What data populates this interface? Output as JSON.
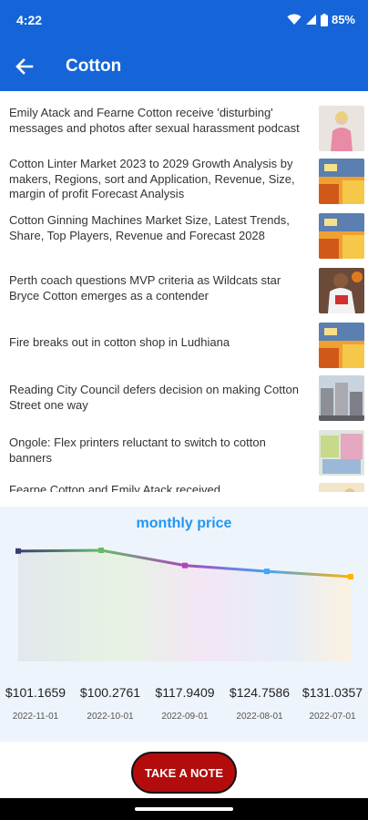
{
  "status_bar": {
    "time": "4:22",
    "battery": "85%"
  },
  "app_bar": {
    "title": "Cotton",
    "back_icon": "arrow-left-icon"
  },
  "news": [
    {
      "text": "Emily Atack and Fearne Cotton receive 'disturbing' messages and photos after sexual harassment podcast",
      "thumb": "woman-pink"
    },
    {
      "text": "Cotton Linter Market 2023 to 2029 Growth Analysis by makers, Regions, sort and Application, Revenue, Size, margin of profit Forecast Analysis",
      "thumb": "market-generic"
    },
    {
      "text": "Cotton Ginning Machines Market Size, Latest Trends, Share, Top Players, Revenue and Forecast 2028",
      "thumb": "market-generic"
    },
    {
      "text": "Perth coach questions MVP criteria as Wildcats star Bryce Cotton emerges as a contender",
      "thumb": "basketball"
    },
    {
      "text": "Fire breaks out in cotton shop in Ludhiana",
      "thumb": "market-generic"
    },
    {
      "text": "Reading City Council defers decision on making Cotton Street one way",
      "thumb": "city-street"
    },
    {
      "text": "Ongole: Flex printers reluctant to switch to cotton banners",
      "thumb": "banners"
    },
    {
      "text": "Fearne Cotton and Emily Atack received",
      "thumb": "partial"
    }
  ],
  "chart_data": {
    "type": "line",
    "title": "monthly price",
    "categories": [
      "2022-11-01",
      "2022-10-01",
      "2022-09-01",
      "2022-08-01",
      "2022-07-01"
    ],
    "value_labels": [
      "$101.1659",
      "$100.2761",
      "$117.9409",
      "$124.7586",
      "$131.0357"
    ],
    "values": [
      101.1659,
      100.2761,
      117.9409,
      124.7586,
      131.0357
    ],
    "grid": false,
    "legend": "none",
    "point_colors": [
      "#3a3f6e",
      "#66bb6a",
      "#ab47bc",
      "#42a5f5",
      "#ffb300"
    ]
  },
  "actions": {
    "take_note": "TAKE A NOTE"
  },
  "colors": {
    "primary": "#1565d8",
    "button": "#b20c0c",
    "chart_title": "#2196f3"
  }
}
